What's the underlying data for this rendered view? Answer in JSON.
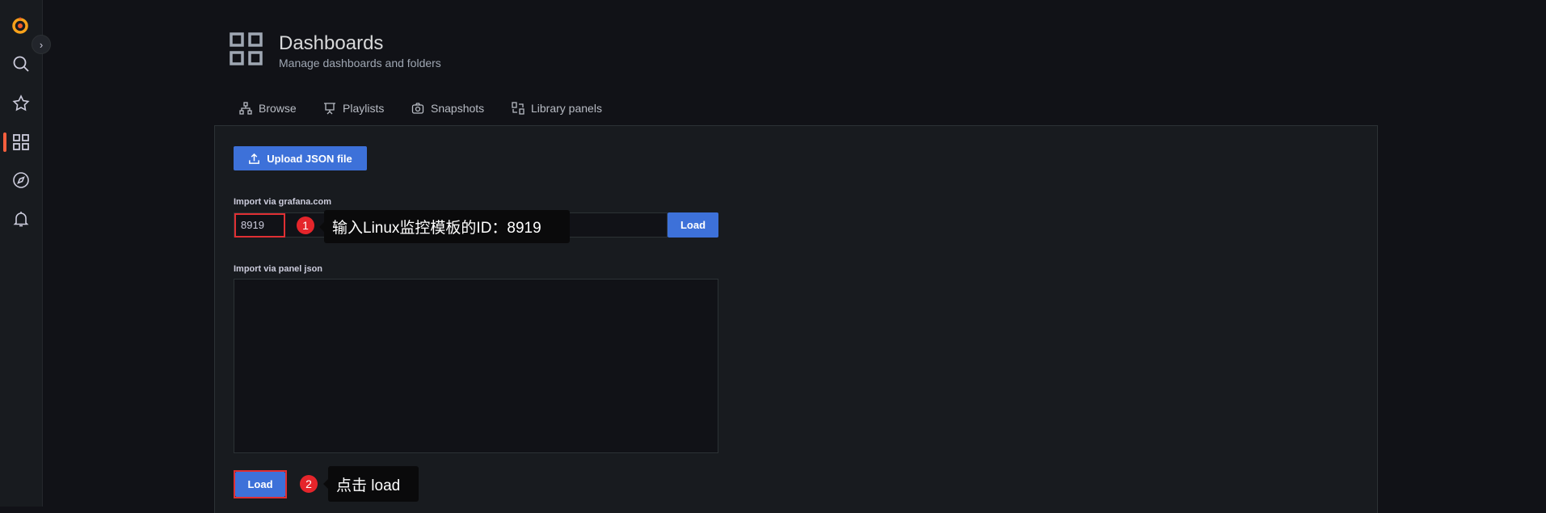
{
  "sidebar": {
    "items": [
      {
        "icon": "search-icon"
      },
      {
        "icon": "star-icon"
      },
      {
        "icon": "dashboards-icon",
        "active": true
      },
      {
        "icon": "compass-icon"
      },
      {
        "icon": "bell-icon"
      }
    ],
    "accent": "#f55f3e"
  },
  "header": {
    "title": "Dashboards",
    "subtitle": "Manage dashboards and folders"
  },
  "tabs": [
    {
      "label": "Browse"
    },
    {
      "label": "Playlists"
    },
    {
      "label": "Snapshots"
    },
    {
      "label": "Library panels"
    }
  ],
  "import": {
    "upload_label": "Upload JSON file",
    "grafana_label": "Import via grafana.com",
    "grafana_value": "8919",
    "load_label": "Load",
    "panel_json_label": "Import via panel json",
    "panel_json_value": "",
    "load2_label": "Load"
  },
  "annotations": [
    {
      "number": "1",
      "text": "输入Linux监控模板的ID：8919"
    },
    {
      "number": "2",
      "text": "点击 load"
    }
  ],
  "colors": {
    "primary": "#3d71d9",
    "background": "#111217",
    "annotation_red": "#e02f33"
  }
}
